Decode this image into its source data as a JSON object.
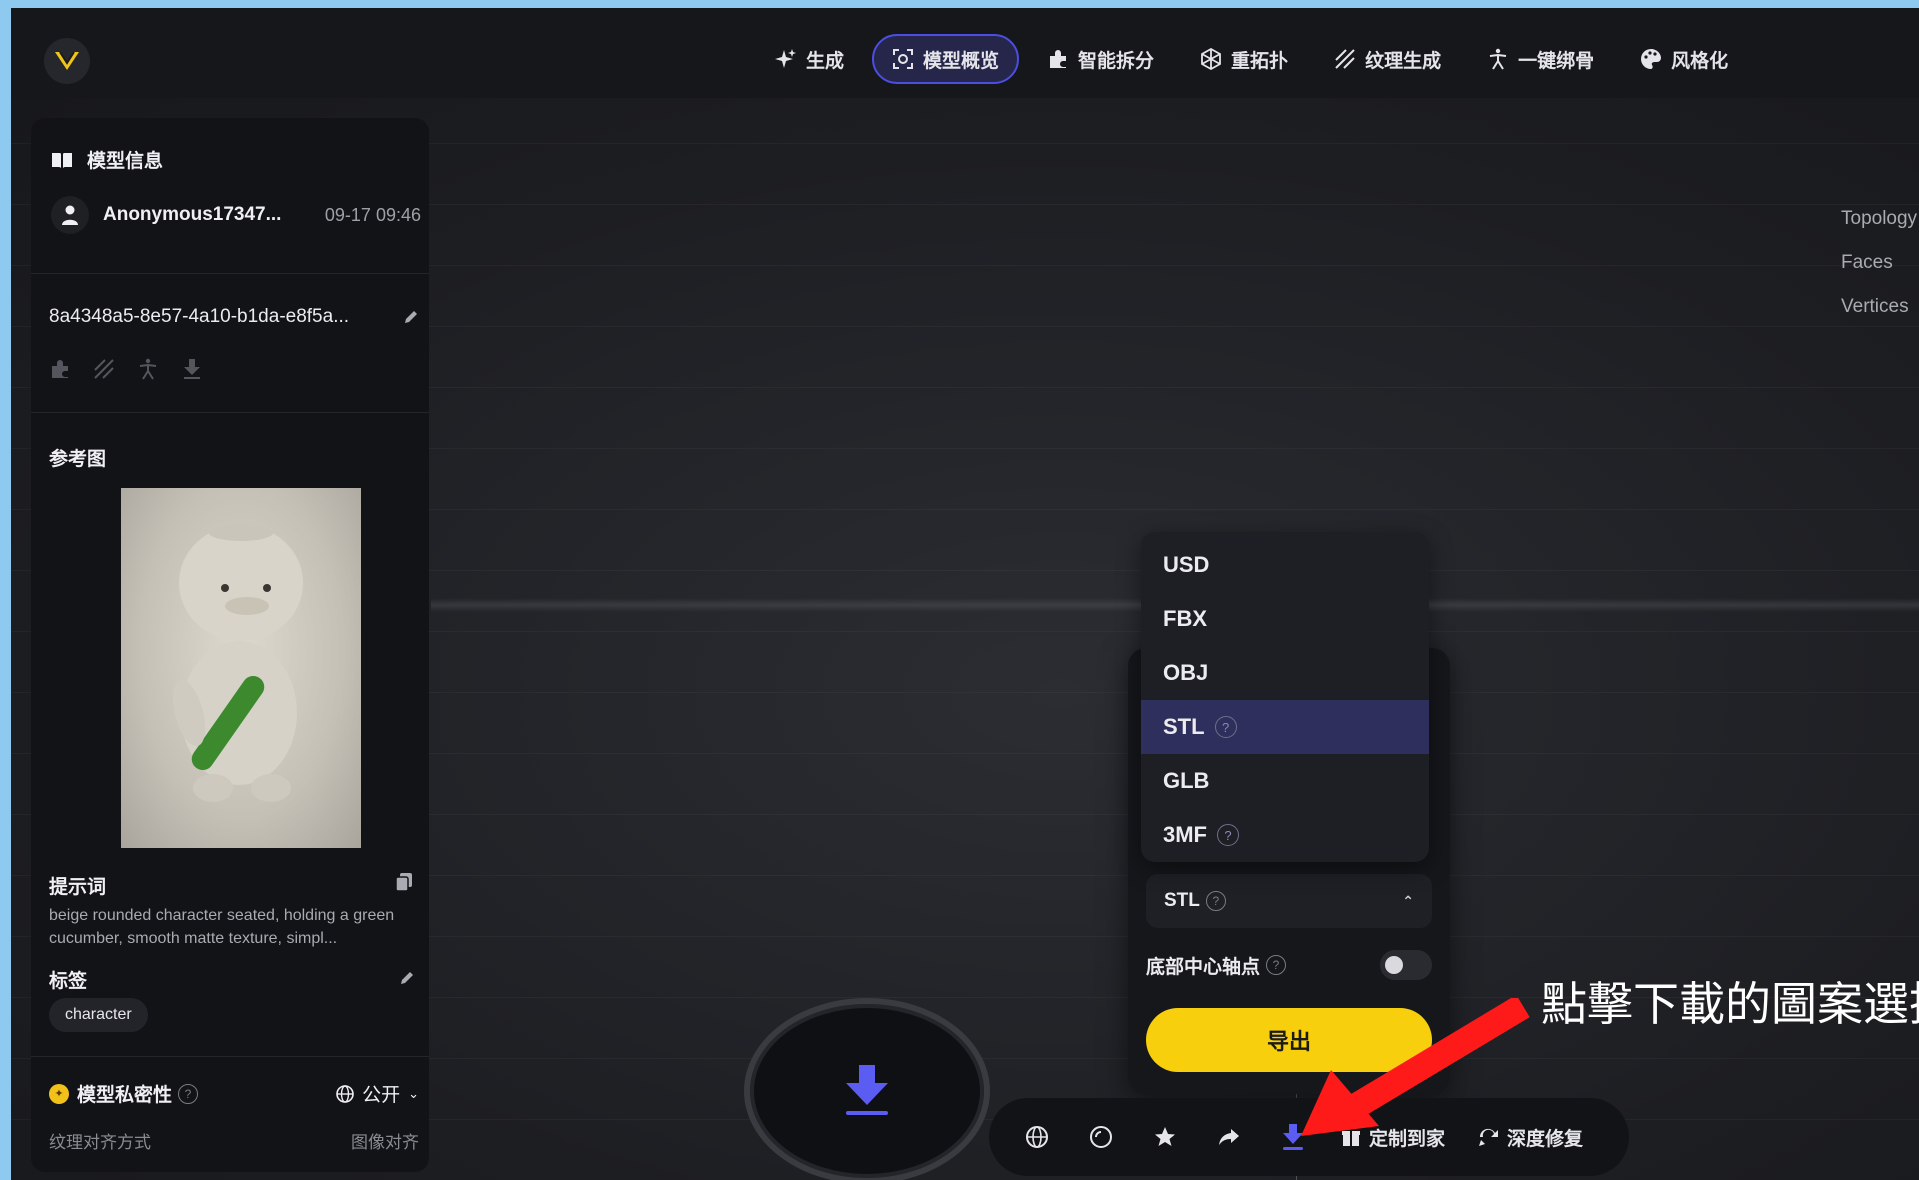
{
  "nav": {
    "items": [
      {
        "label": "生成",
        "icon": "sparkle-icon"
      },
      {
        "label": "模型概览",
        "icon": "model-overview-icon",
        "active": true
      },
      {
        "label": "智能拆分",
        "icon": "puzzle-icon"
      },
      {
        "label": "重拓扑",
        "icon": "retopology-icon"
      },
      {
        "label": "纹理生成",
        "icon": "texture-icon"
      },
      {
        "label": "一键绑骨",
        "icon": "rigging-icon"
      },
      {
        "label": "风格化",
        "icon": "palette-icon"
      }
    ]
  },
  "stats": {
    "topology": "Topology",
    "faces": "Faces",
    "vertices": "Vertices"
  },
  "sidebar": {
    "title": "模型信息",
    "user_name": "Anonymous17347...",
    "timestamp": "09-17 09:46",
    "model_id": "8a4348a5-8e57-4a10-b1da-e8f5a...",
    "reference_label": "参考图",
    "prompt_label": "提示词",
    "prompt_text": "beige rounded character seated, holding a green cucumber, smooth matte texture, simpl...",
    "tags_label": "标签",
    "tag": "character",
    "privacy_label": "模型私密性",
    "privacy_value": "公开",
    "cut_left": "纹理对齐方式",
    "cut_right": "图像对齐"
  },
  "export": {
    "formats": [
      {
        "label": "USD",
        "help": false
      },
      {
        "label": "FBX",
        "help": false
      },
      {
        "label": "OBJ",
        "help": false
      },
      {
        "label": "STL",
        "help": true,
        "selected": true
      },
      {
        "label": "GLB",
        "help": false
      },
      {
        "label": "3MF",
        "help": true
      }
    ],
    "selected_format": "STL",
    "pivot_label": "底部中心轴点",
    "pivot_enabled": false,
    "export_button": "导出"
  },
  "bottombar": {
    "customize_label": "定制到家",
    "repair_label": "深度修复"
  },
  "annotation": {
    "text": "點擊下載的圖案選擇",
    "color": "#ff1a1a"
  },
  "colors": {
    "accent": "#5b5cf2",
    "export": "#f7cf0c",
    "background": "#1c1d21"
  }
}
